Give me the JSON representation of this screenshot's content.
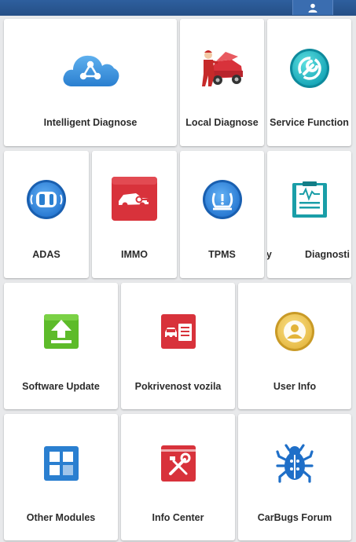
{
  "header": {
    "user_icon": "user-icon"
  },
  "tiles": {
    "intelligent_diagnose": {
      "label": "Intelligent Diagnose",
      "icon": "cloud-network-icon"
    },
    "local_diagnose": {
      "label": "Local Diagnose",
      "icon": "mechanic-car-icon"
    },
    "service_function": {
      "label": "Service Function",
      "icon": "wrench-gear-icon"
    },
    "adas": {
      "label": "ADAS",
      "icon": "car-radar-icon"
    },
    "immo": {
      "label": "IMMO",
      "icon": "car-key-icon"
    },
    "tpms": {
      "label": "TPMS",
      "icon": "tire-pressure-icon"
    },
    "history_partial": {
      "label": "ry",
      "icon": ""
    },
    "diagnostic_partial": {
      "label": "Diagnosti",
      "icon": "clipboard-report-icon"
    },
    "software_update": {
      "label": "Software Update",
      "icon": "upload-arrow-icon"
    },
    "vehicle_coverage": {
      "label": "Pokrivenost vozila",
      "icon": "car-list-icon"
    },
    "user_info": {
      "label": "User Info",
      "icon": "user-circle-icon"
    },
    "other_modules": {
      "label": "Other Modules",
      "icon": "grid-modules-icon"
    },
    "info_center": {
      "label": "Info Center",
      "icon": "tools-book-icon"
    },
    "carbugs_forum": {
      "label": "CarBugs Forum",
      "icon": "bug-icon"
    }
  }
}
